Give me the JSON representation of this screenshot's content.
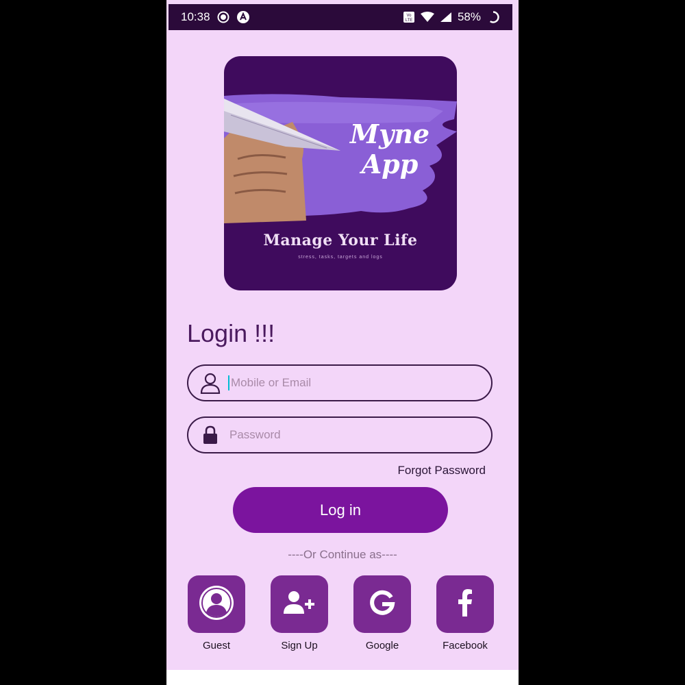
{
  "status_bar": {
    "time": "10:38",
    "battery_percent": "58%",
    "icons": [
      "record-icon",
      "app-a-icon",
      "volte-icon",
      "wifi-icon",
      "signal-icon",
      "battery-icon"
    ]
  },
  "logo": {
    "title_line1": "Myne",
    "title_line2": "App",
    "tagline": "Manage Your Life",
    "subtitle": "stress, tasks, targets and logs"
  },
  "login": {
    "heading": "Login !!!",
    "email_placeholder": "Mobile or Email",
    "password_placeholder": "Password",
    "forgot_password": "Forgot Password",
    "login_button": "Log in",
    "continue_as": "----Or Continue as----"
  },
  "social": [
    {
      "label": "Guest",
      "icon": "user-circle-icon"
    },
    {
      "label": "Sign Up",
      "icon": "user-plus-icon"
    },
    {
      "label": "Google",
      "icon": "google-icon"
    },
    {
      "label": "Facebook",
      "icon": "facebook-icon"
    }
  ],
  "colors": {
    "background": "#f3d6f9",
    "primary": "#7b149e",
    "tile": "#7a2a92",
    "status_bar": "#2b0a3a",
    "logo_bg": "#3f0b5d"
  }
}
